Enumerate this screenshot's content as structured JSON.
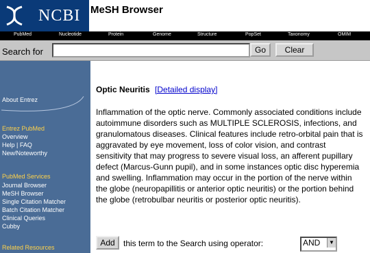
{
  "header": {
    "logo_text": "NCBI",
    "page_title": "MeSH Browser"
  },
  "nav": {
    "items": [
      "PubMed",
      "Nucleotide",
      "Protein",
      "Genome",
      "Structure",
      "PopSet",
      "Taxonomy",
      "OMIM"
    ]
  },
  "search": {
    "label": "Search for",
    "value": "",
    "go_label": "Go",
    "clear_label": "Clear"
  },
  "sidebar": {
    "about": "About Entrez",
    "entrez_heading": "Entrez PubMed",
    "entrez_links": [
      "Overview",
      "Help | FAQ",
      "New/Noteworthy"
    ],
    "services_heading": "PubMed Services",
    "services_links": [
      "Journal Browser",
      "MeSH Browser",
      "Single Citation Matcher",
      "Batch Citation Matcher",
      "Clinical Queries",
      "Cubby"
    ],
    "related_heading": "Related Resources"
  },
  "main": {
    "term": "Optic Neuritis",
    "detail_link": "[Detailed display]",
    "definition": "Inflammation of the optic nerve. Commonly associated conditions include autoimmune disorders such as MULTIPLE SCLEROSIS, infections, and granulomatous diseases. Clinical features include retro-orbital pain that is aggravated by eye movement, loss of color vision, and contrast sensitivity that may progress to severe visual loss, an afferent pupillary defect (Marcus-Gunn pupil), and in some instances optic disc hyperemia and swelling. Inflammation may occur in the portion of the nerve within the globe (neuropapillitis or anterior optic neuritis) or the portion behind the globe (retrobulbar neuritis or posterior optic neuritis).",
    "add_button": "Add",
    "add_text": "this term to the Search using operator:",
    "operator": "AND"
  },
  "colors": {
    "logo_bg": "#0a3a78",
    "sidebar_bg": "#4a6c96",
    "sidebar_heading": "#ffd24a",
    "link": "#0000cc"
  }
}
